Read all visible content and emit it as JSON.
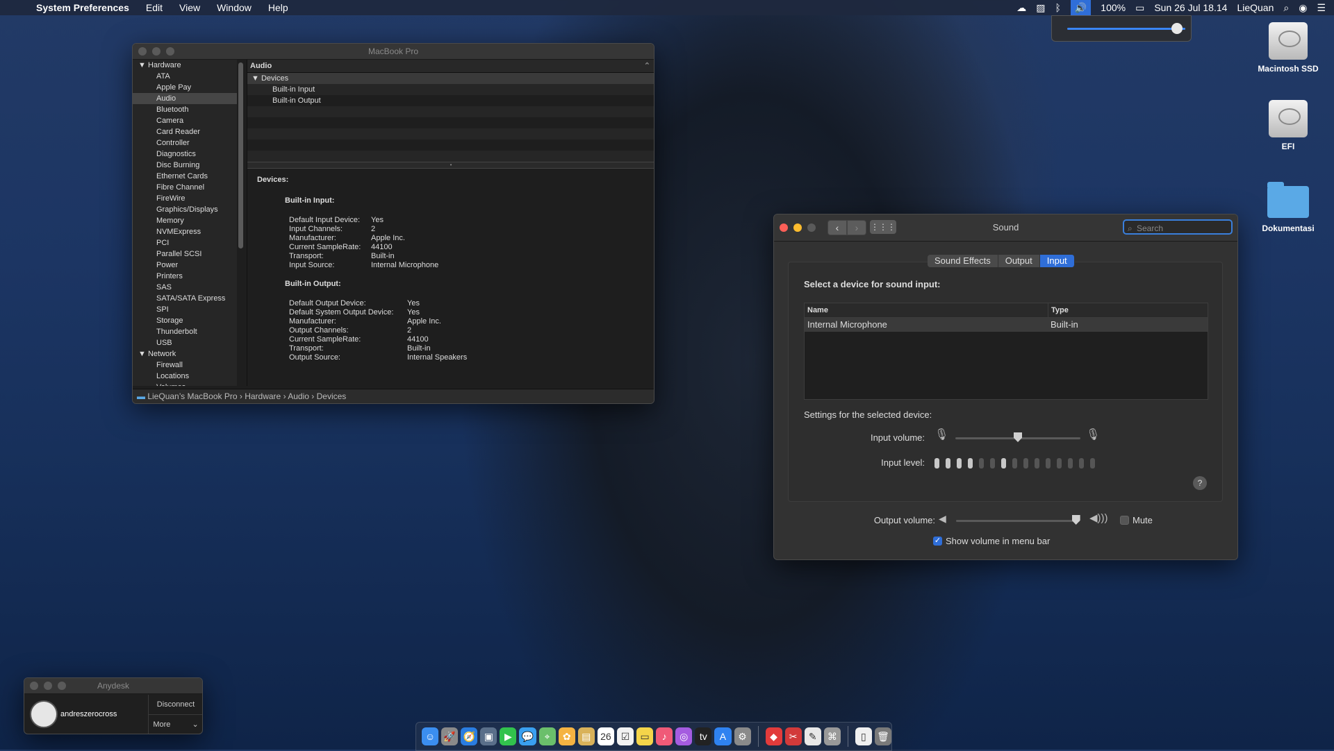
{
  "menubar": {
    "app": "System Preferences",
    "menus": [
      "Edit",
      "View",
      "Window",
      "Help"
    ],
    "battery": "100%",
    "clock": "Sun 26 Jul  18.14",
    "user": "LieQuan",
    "volume_level": 1.0
  },
  "desktop": {
    "icons": [
      {
        "label": "Macintosh SSD",
        "icon": "disk-icon"
      },
      {
        "label": "EFI",
        "icon": "disk-icon"
      },
      {
        "label": "Dokumentasi",
        "icon": "folder-icon"
      }
    ]
  },
  "sysinfo": {
    "title": "MacBook Pro",
    "sidebar": {
      "hardware_label": "Hardware",
      "hardware": [
        "ATA",
        "Apple Pay",
        "Audio",
        "Bluetooth",
        "Camera",
        "Card Reader",
        "Controller",
        "Diagnostics",
        "Disc Burning",
        "Ethernet Cards",
        "Fibre Channel",
        "FireWire",
        "Graphics/Displays",
        "Memory",
        "NVMExpress",
        "PCI",
        "Parallel SCSI",
        "Power",
        "Printers",
        "SAS",
        "SATA/SATA Express",
        "SPI",
        "Storage",
        "Thunderbolt",
        "USB"
      ],
      "selected": "Audio",
      "network_label": "Network",
      "network": [
        "Firewall",
        "Locations",
        "Volumes"
      ]
    },
    "main_header": "Audio",
    "tree": {
      "group": "Devices",
      "items": [
        "Built-in Input",
        "Built-in Output"
      ]
    },
    "detail": {
      "heading": "Devices:",
      "input_title": "Built-in Input:",
      "input_rows": [
        {
          "k": "Default Input Device:",
          "v": "Yes"
        },
        {
          "k": "Input Channels:",
          "v": "2"
        },
        {
          "k": "Manufacturer:",
          "v": "Apple Inc."
        },
        {
          "k": "Current SampleRate:",
          "v": "44100"
        },
        {
          "k": "Transport:",
          "v": "Built-in"
        },
        {
          "k": "Input Source:",
          "v": "Internal Microphone"
        }
      ],
      "output_title": "Built-in Output:",
      "output_rows": [
        {
          "k": "Default Output Device:",
          "v": "Yes"
        },
        {
          "k": "Default System Output Device:",
          "v": "Yes"
        },
        {
          "k": "Manufacturer:",
          "v": "Apple Inc."
        },
        {
          "k": "Output Channels:",
          "v": "2"
        },
        {
          "k": "Current SampleRate:",
          "v": "44100"
        },
        {
          "k": "Transport:",
          "v": "Built-in"
        },
        {
          "k": "Output Source:",
          "v": "Internal Speakers"
        }
      ]
    },
    "path": [
      "LieQuan’s MacBook Pro",
      "Hardware",
      "Audio",
      "Devices"
    ]
  },
  "sound": {
    "title": "Sound",
    "search_placeholder": "Search",
    "tabs": [
      "Sound Effects",
      "Output",
      "Input"
    ],
    "active_tab": "Input",
    "select_label": "Select a device for sound input:",
    "table": {
      "headers": [
        "Name",
        "Type"
      ],
      "rows": [
        {
          "name": "Internal Microphone",
          "type": "Built-in"
        }
      ]
    },
    "settings_label": "Settings for the selected device:",
    "input_volume_label": "Input volume:",
    "input_volume": 0.5,
    "input_level_label": "Input level:",
    "input_level_on": [
      1,
      2,
      3,
      4,
      7
    ],
    "input_level_count": 15,
    "output_volume_label": "Output volume:",
    "output_volume": 0.97,
    "mute_label": "Mute",
    "mute_checked": false,
    "show_volume_label": "Show volume in menu bar",
    "show_volume_checked": true,
    "help": "?"
  },
  "anydesk": {
    "title": "Anydesk",
    "user": "andreszerocross",
    "disconnect": "Disconnect",
    "more": "More"
  },
  "dock": {
    "apps": [
      "finder-icon",
      "launchpad-icon",
      "safari-icon",
      "preview-icon",
      "facetime-icon",
      "messages-icon",
      "maps-icon",
      "photos-icon",
      "notes-icon",
      "calendar-icon",
      "reminders-icon",
      "notes2-icon",
      "music-icon",
      "podcasts-icon",
      "tv-icon",
      "appstore-icon",
      "system-preferences-icon",
      "anydesk-icon",
      "photo-booth-icon",
      "textedit-icon",
      "script-editor-icon",
      "document-icon",
      "trash-icon"
    ],
    "calendar_day": "26"
  },
  "colors": {
    "accent": "#2f6ed8",
    "close": "#fc5f57",
    "minimize": "#fdbc2e"
  }
}
